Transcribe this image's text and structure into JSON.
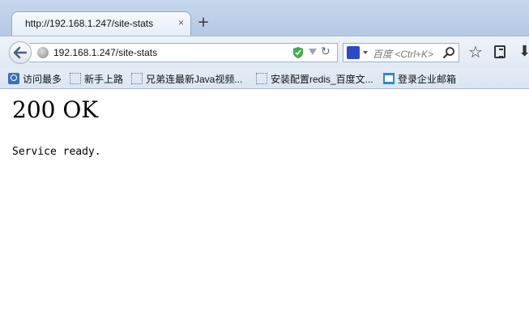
{
  "browser": {
    "tab": {
      "title": "http://192.168.1.247/site-stats",
      "close": "×"
    },
    "new_tab": "+",
    "address": {
      "url": "192.168.1.247/site-stats"
    },
    "search": {
      "placeholder": "百度 <Ctrl+K>",
      "engine": "baidu"
    },
    "icons": [
      "back-arrow-icon",
      "globe-icon",
      "shield-icon",
      "dropdown-icon",
      "reload-icon",
      "search-engine-icon",
      "magnifier-icon",
      "star-icon",
      "reader-icon",
      "download-icon"
    ],
    "accent": "#c7d7ec"
  },
  "bookmarks": [
    {
      "label": "访问最多",
      "icon": "most-visited-icon"
    },
    {
      "label": "新手上路",
      "icon": "placeholder-icon"
    },
    {
      "label": "兄弟连最新Java视频...",
      "icon": "placeholder-icon"
    },
    {
      "label": "安装配置redis_百度文...",
      "icon": "placeholder-icon"
    },
    {
      "label": "登录企业邮箱",
      "icon": "mail-icon"
    }
  ],
  "page": {
    "title": "200 OK",
    "body": "Service ready."
  }
}
